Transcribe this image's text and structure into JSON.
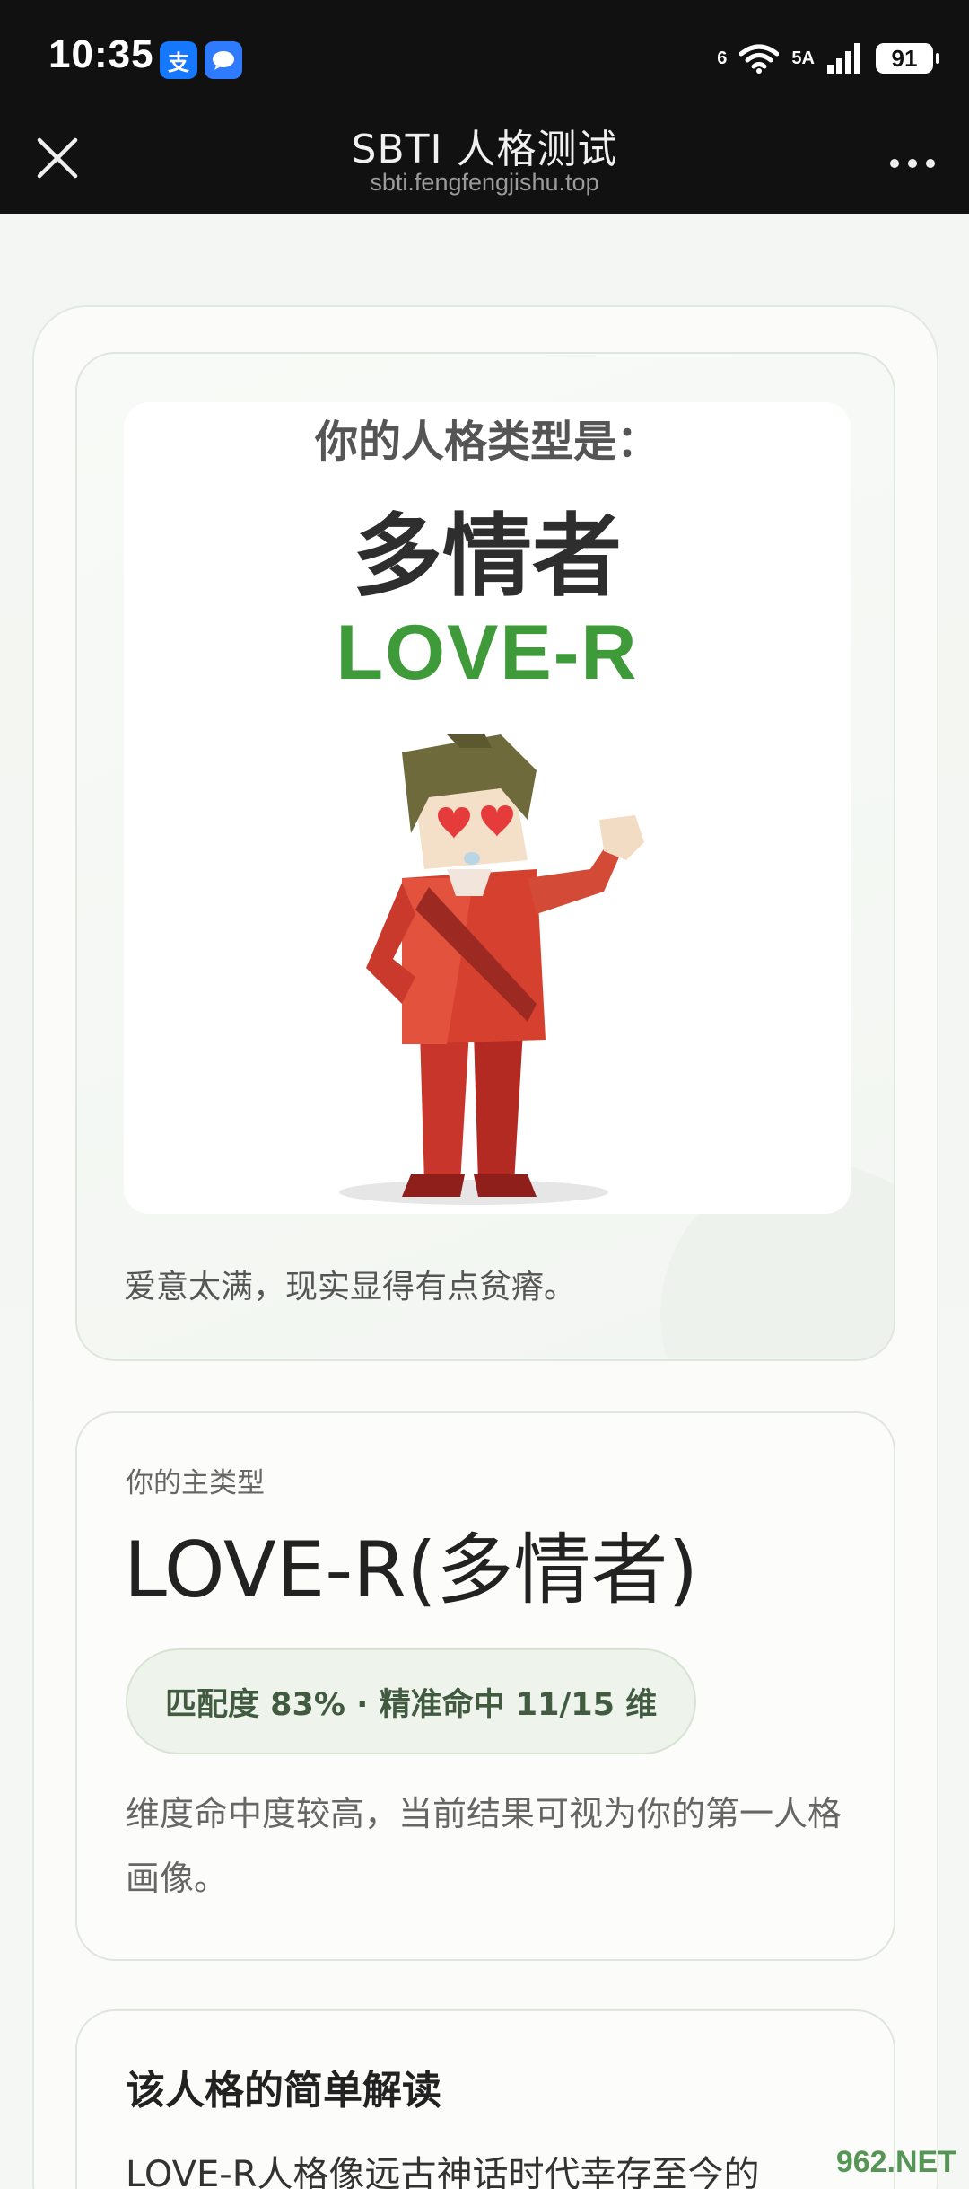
{
  "status_bar": {
    "time": "10:35",
    "app_icons": [
      "alipay-icon",
      "message-icon"
    ],
    "network": "5A",
    "signal_tag": "6",
    "battery": "91"
  },
  "title_bar": {
    "title": "SBTI 人格测试",
    "url": "sbti.fengfengjishu.top"
  },
  "result_card": {
    "poster_heading": "你的人格类型是：",
    "poster_type": "多情者",
    "poster_code": "LOVE-R",
    "caption": "爱意太满，现实显得有点贫瘠。"
  },
  "main_type_card": {
    "label": "你的主类型",
    "title": "LOVE-R(多情者)",
    "match": "匹配度 83% · 精准命中 11/15 维",
    "description": "维度命中度较高，当前结果可视为你的第一人格画像。"
  },
  "reading_card": {
    "title": "该人格的简单解读",
    "text": "LOVE-R人格像远古神话时代幸存至今的"
  },
  "watermark": "962.NET",
  "colors": {
    "accent_green": "#3f9a3a",
    "pill_bg": "#eef3ec",
    "bar_bg": "#111111"
  }
}
